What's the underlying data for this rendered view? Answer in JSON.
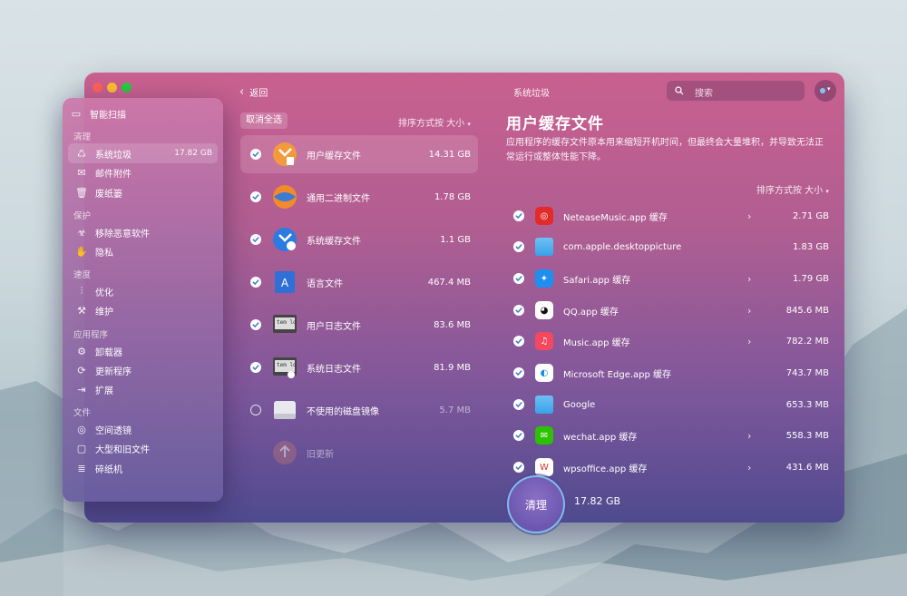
{
  "window": {
    "title": "系统垃圾",
    "back_label": "返回",
    "search_placeholder": "搜索"
  },
  "sidebar": {
    "top_item": {
      "label": "智能扫描",
      "icon": "monitor-icon"
    },
    "sections": [
      {
        "title": "清理",
        "items": [
          {
            "label": "系统垃圾",
            "icon": "trash-bin-icon",
            "size": "17.82 GB",
            "active": true
          },
          {
            "label": "邮件附件",
            "icon": "mail-icon"
          },
          {
            "label": "废纸篓",
            "icon": "trash-can-icon"
          }
        ]
      },
      {
        "title": "保护",
        "items": [
          {
            "label": "移除恶意软件",
            "icon": "biohazard-icon"
          },
          {
            "label": "隐私",
            "icon": "hand-icon"
          }
        ]
      },
      {
        "title": "速度",
        "items": [
          {
            "label": "优化",
            "icon": "sliders-icon"
          },
          {
            "label": "维护",
            "icon": "wrench-icon"
          }
        ]
      },
      {
        "title": "应用程序",
        "items": [
          {
            "label": "卸载器",
            "icon": "uninstaller-icon"
          },
          {
            "label": "更新程序",
            "icon": "updater-icon"
          },
          {
            "label": "扩展",
            "icon": "extensions-icon"
          }
        ]
      },
      {
        "title": "文件",
        "items": [
          {
            "label": "空间透镜",
            "icon": "lens-icon"
          },
          {
            "label": "大型和旧文件",
            "icon": "folder-icon"
          },
          {
            "label": "碎纸机",
            "icon": "shredder-icon"
          }
        ]
      }
    ]
  },
  "middle": {
    "deselect_all": "取消全选",
    "sort_label": "排序方式按 大小",
    "items": [
      {
        "label": "用户缓存文件",
        "size": "14.31 GB",
        "checked": true,
        "selected": true,
        "icon": "user-cache-icon"
      },
      {
        "label": "通用二进制文件",
        "size": "1.78 GB",
        "checked": true,
        "icon": "universal-binary-icon"
      },
      {
        "label": "系统缓存文件",
        "size": "1.1 GB",
        "checked": true,
        "icon": "system-cache-icon"
      },
      {
        "label": "语言文件",
        "size": "467.4 MB",
        "checked": true,
        "icon": "language-file-icon"
      },
      {
        "label": "用户日志文件",
        "size": "83.6 MB",
        "checked": true,
        "icon": "user-log-icon"
      },
      {
        "label": "系统日志文件",
        "size": "81.9 MB",
        "checked": true,
        "icon": "system-log-icon"
      },
      {
        "label": "不使用的磁盘镜像",
        "size": "5.7 MB",
        "checked": false,
        "icon": "disk-image-icon"
      },
      {
        "label": "旧更新",
        "size": "",
        "checked": false,
        "icon": "old-updates-icon"
      }
    ]
  },
  "detail": {
    "title": "用户缓存文件",
    "description": "应用程序的缓存文件原本用来缩短开机时间，但最终会大量堆积，并导致无法正常运行或整体性能下降。",
    "sort_label": "排序方式按 大小",
    "items": [
      {
        "label": "NeteaseMusic.app 缓存",
        "size": "2.71 GB",
        "arrow": true,
        "icon": "netease-music-icon",
        "color": "#e22a2a"
      },
      {
        "label": "com.apple.desktoppicture",
        "size": "1.83 GB",
        "arrow": false,
        "icon": "folder-icon",
        "color": "#3aa2e8"
      },
      {
        "label": "Safari.app 缓存",
        "size": "1.79 GB",
        "arrow": true,
        "icon": "safari-icon",
        "color": "#1e8ff0"
      },
      {
        "label": "QQ.app 缓存",
        "size": "845.6 MB",
        "arrow": true,
        "icon": "qq-icon",
        "color": "#ffffff"
      },
      {
        "label": "Music.app 缓存",
        "size": "782.2 MB",
        "arrow": true,
        "icon": "music-icon",
        "color": "#f5485e"
      },
      {
        "label": "Microsoft Edge.app 缓存",
        "size": "743.7 MB",
        "arrow": false,
        "icon": "edge-icon",
        "color": "#ffffff"
      },
      {
        "label": "Google",
        "size": "653.3 MB",
        "arrow": false,
        "icon": "folder-icon",
        "color": "#3aa2e8"
      },
      {
        "label": "wechat.app 缓存",
        "size": "558.3 MB",
        "arrow": true,
        "icon": "wechat-icon",
        "color": "#2dc100"
      },
      {
        "label": "wpsoffice.app 缓存",
        "size": "431.6 MB",
        "arrow": true,
        "icon": "wps-icon",
        "color": "#ffffff"
      }
    ]
  },
  "footer": {
    "clean_label": "清理",
    "total": "17.82 GB"
  }
}
